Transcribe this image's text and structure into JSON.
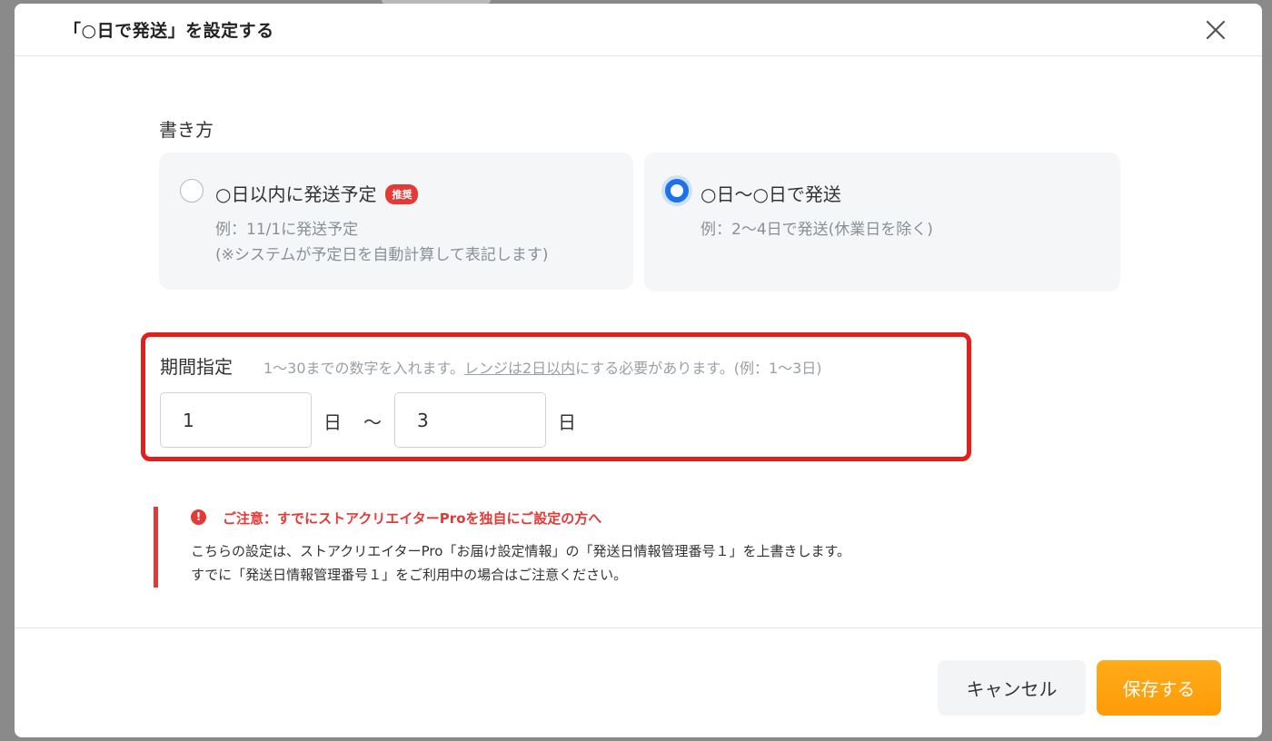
{
  "dialog": {
    "title": "「○日で発送」を設定する"
  },
  "format": {
    "label": "書き方",
    "options": [
      {
        "title": "○日以内に発送予定",
        "badge": "推奨",
        "desc_line1": "例：11/1に発送予定",
        "desc_line2": "(※システムが予定日を自動計算して表記します)",
        "selected": false
      },
      {
        "title": "○日〜○日で発送",
        "desc_line1": "例：2〜4日で発送(休業日を除く)",
        "selected": true
      }
    ]
  },
  "period": {
    "label": "期間指定",
    "hint_before": "1〜30までの数字を入れます。",
    "hint_link": "レンジは2日以内",
    "hint_after": "にする必要があります。(例：1〜3日)",
    "from_value": "1",
    "to_value": "3",
    "unit": "日",
    "tilde": "〜"
  },
  "notice": {
    "title": "ご注意：すでにストアクリエイターProを独自にご設定の方へ",
    "line1": "こちらの設定は、ストアクリエイターPro「お届け設定情報」の「発送日情報管理番号１」を上書きします。",
    "line2": "すでに「発送日情報管理番号１」をご利用中の場合はご注意ください。"
  },
  "footer": {
    "cancel_label": "キャンセル",
    "save_label": "保存する"
  },
  "colors": {
    "accent_blue": "#1a73e8",
    "warning_red": "#e53935",
    "highlight_red": "#e0201b",
    "save_orange": "#ff9b06"
  },
  "icons": {
    "close": "close-icon",
    "notice": "exclamation-circle-icon"
  }
}
